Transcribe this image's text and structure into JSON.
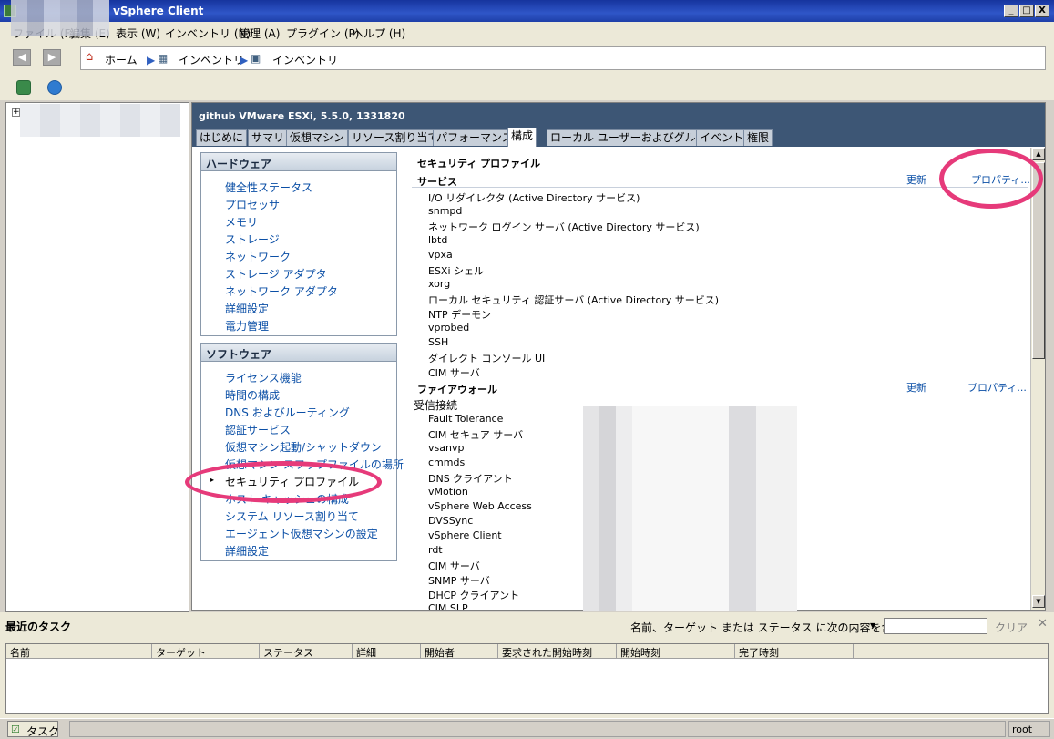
{
  "window": {
    "title": "vSphere Client",
    "min": "_",
    "max": "□",
    "close": "X"
  },
  "menu": [
    "ファイル (F)",
    "編集 (E)",
    "表示 (W)",
    "インベントリ (N)",
    "管理 (A)",
    "プラグイン (P)",
    "ヘルプ (H)"
  ],
  "breadcrumb": {
    "home": "ホーム",
    "inv1": "インベントリ",
    "inv2": "インベントリ"
  },
  "host": {
    "header": "github VMware ESXi, 5.5.0, 1331820",
    "tabs": [
      "はじめに",
      "サマリ",
      "仮想マシン",
      "リソース割り当て",
      "パフォーマンス",
      "構成",
      "ローカル ユーザーおよびグループ",
      "イベント",
      "権限"
    ],
    "active_tab": "構成"
  },
  "hardware": {
    "title": "ハードウェア",
    "items": [
      "健全性ステータス",
      "プロセッサ",
      "メモリ",
      "ストレージ",
      "ネットワーク",
      "ストレージ アダプタ",
      "ネットワーク アダプタ",
      "詳細設定",
      "電力管理"
    ]
  },
  "software": {
    "title": "ソフトウェア",
    "items": [
      "ライセンス機能",
      "時間の構成",
      "DNS およびルーティング",
      "認証サービス",
      "仮想マシン起動/シャットダウン",
      "仮想マシン スワップファイルの場所",
      "セキュリティ プロファイル",
      "ホスト キャッシュの構成",
      "システム リソース割り当て",
      "エージェント仮想マシンの設定",
      "詳細設定"
    ],
    "selected_marker": "▸"
  },
  "security": {
    "title": "セキュリティ プロファイル",
    "services_title": "サービス",
    "refresh": "更新",
    "properties": "プロパティ...",
    "services": [
      "I/O リダイレクタ (Active Directory サービス)",
      "snmpd",
      "ネットワーク ログイン サーバ (Active Directory サービス)",
      "lbtd",
      "vpxa",
      "ESXi シェル",
      "xorg",
      "ローカル セキュリティ 認証サーバ (Active Directory サービス)",
      "NTP デーモン",
      "vprobed",
      "SSH",
      "ダイレクト コンソール UI",
      "CIM サーバ"
    ],
    "firewall_title": "ファイアウォール",
    "incoming": "受信接続",
    "firewall": [
      "Fault Tolerance",
      "CIM セキュア サーバ",
      "vsanvp",
      "cmmds",
      "DNS クライアント",
      "vMotion",
      "vSphere Web Access",
      "DVSSync",
      "vSphere Client",
      "rdt",
      "CIM サーバ",
      "SNMP サーバ",
      "DHCP クライアント",
      "CIM SLP"
    ]
  },
  "tasks": {
    "title": "最近のタスク",
    "filter_label": "名前、ターゲット または ステータス に次の内容を含む:",
    "clear": "クリア",
    "columns": [
      "名前",
      "ターゲット",
      "ステータス",
      "詳細",
      "開始者",
      "要求された開始時刻",
      "開始時刻",
      "完了時刻"
    ]
  },
  "status": {
    "tasks_button": "タスク",
    "user": "root"
  },
  "colors": {
    "accent_oval": "#e63a7a",
    "header_bg": "#3d5675"
  }
}
